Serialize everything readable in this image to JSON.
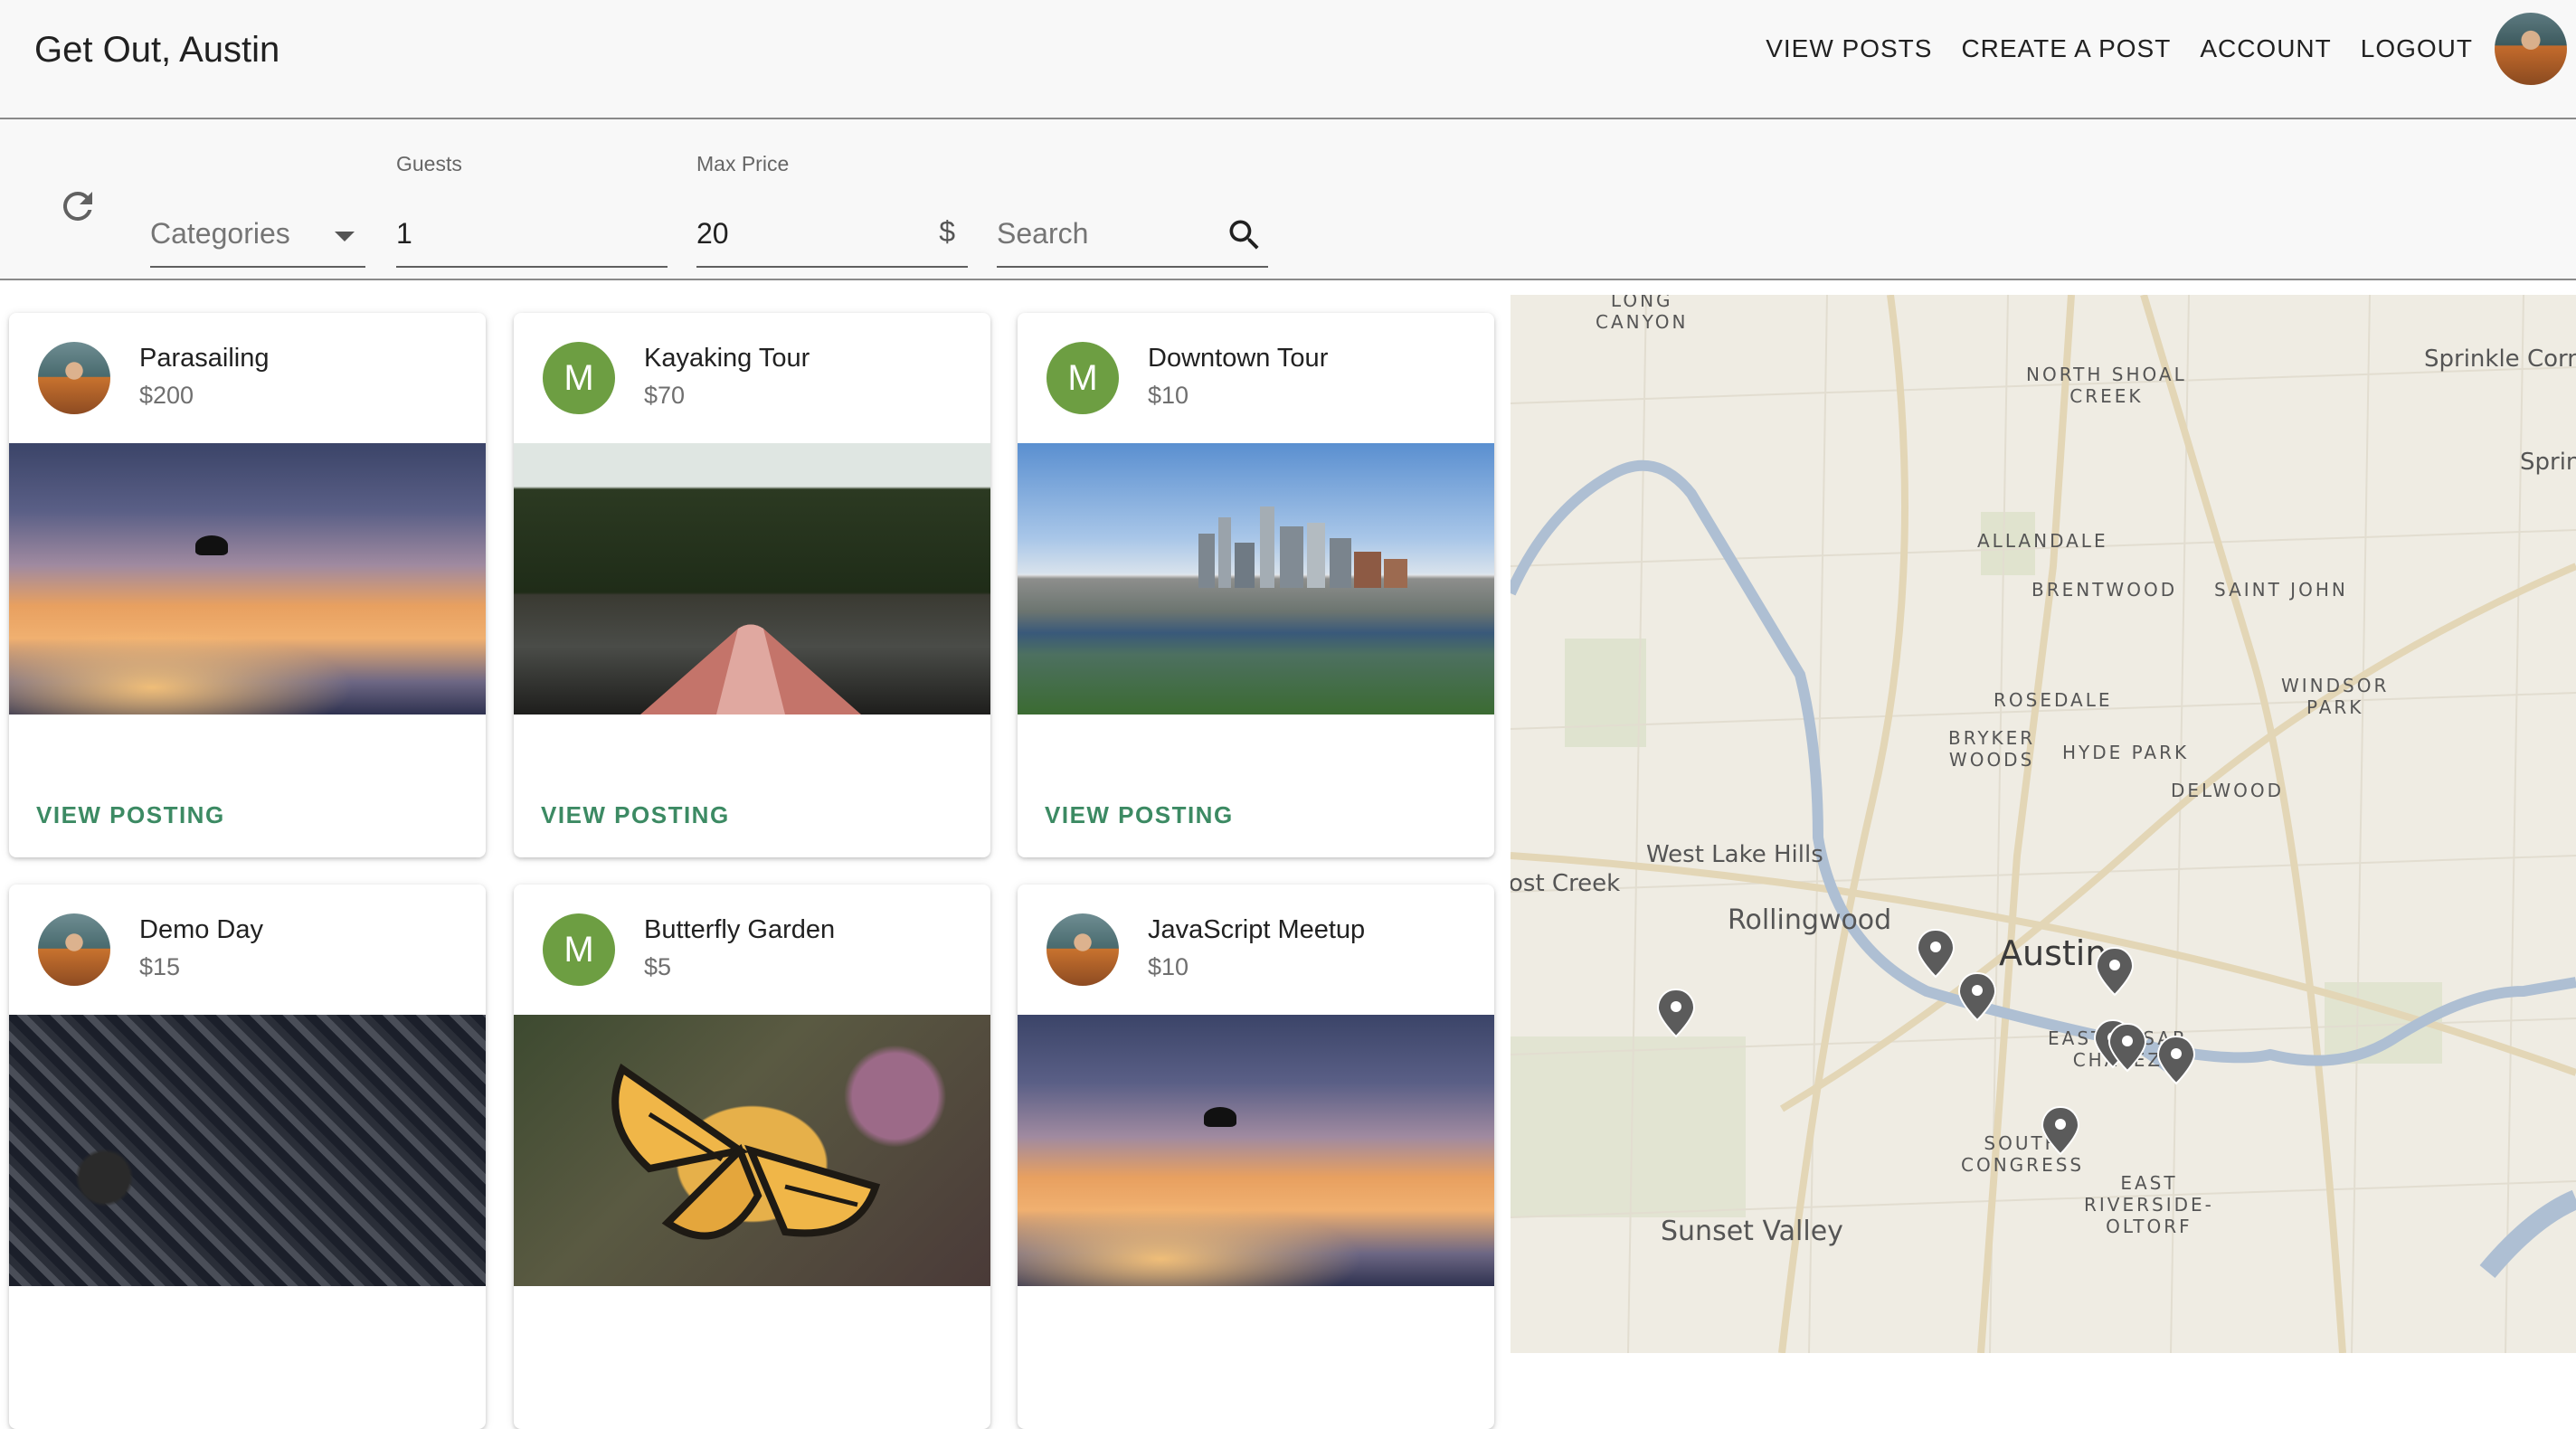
{
  "header": {
    "title": "Get Out, Austin",
    "nav": [
      "VIEW POSTS",
      "CREATE A POST",
      "ACCOUNT",
      "LOGOUT"
    ]
  },
  "filters": {
    "categories_placeholder": "Categories",
    "guests_label": "Guests",
    "guests_value": "1",
    "maxprice_label": "Max Price",
    "maxprice_value": "20",
    "currency_symbol": "$",
    "search_placeholder": "Search"
  },
  "cards": [
    {
      "title": "Parasailing",
      "price": "$200",
      "avatar": "photo",
      "image": "sky",
      "action": "VIEW POSTING"
    },
    {
      "title": "Kayaking Tour",
      "price": "$70",
      "avatar": "M",
      "image": "lake",
      "action": "VIEW POSTING"
    },
    {
      "title": "Downtown Tour",
      "price": "$10",
      "avatar": "M",
      "image": "city",
      "action": "VIEW POSTING"
    },
    {
      "title": "Demo Day",
      "price": "$15",
      "avatar": "photo",
      "image": "crowd"
    },
    {
      "title": "Butterfly Garden",
      "price": "$5",
      "avatar": "M",
      "image": "butterfly"
    },
    {
      "title": "JavaScript Meetup",
      "price": "$10",
      "avatar": "photo",
      "image": "sky"
    }
  ],
  "map": {
    "neighborhoods": [
      "LONG\nCANYON",
      "NORTH SHOAL\nCREEK",
      "ALLANDALE",
      "BRENTWOOD",
      "SAINT JOHN",
      "WINDSOR\nPARK",
      "ROSEDALE",
      "BRYKER\nWOODS",
      "HYDE PARK",
      "DELWOOD",
      "EAST CESAR\nCHAVEZ",
      "SOUTH\nCONGRESS",
      "EAST\nRIVERSIDE-\nOLTORF"
    ],
    "towns": [
      "Sprinkle Corner",
      "Sprin",
      "West Lake Hills",
      "ost Creek",
      "Rollingwood",
      "Sunset Valley"
    ],
    "city": "Austin"
  },
  "colors": {
    "accent": "#3c8a63",
    "avatar_m": "#6d9e42",
    "map_bg": "#efece3",
    "river": "#aebfd3"
  }
}
